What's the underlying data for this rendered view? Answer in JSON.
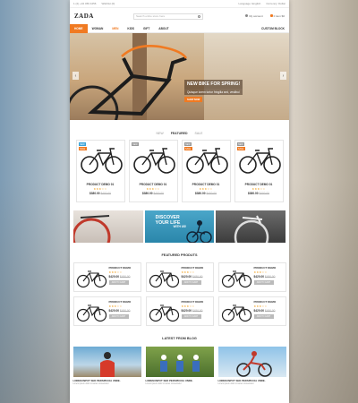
{
  "topbar": {
    "phone": "1 (2) +34 456 4456",
    "wishlist": "Wishlist (0)",
    "language": "Language: English",
    "currency": "Currency: Dollar"
  },
  "header": {
    "logo": "ZADA",
    "search_placeholder": "Search entire store here",
    "account": "My account",
    "cart": "0 item $0"
  },
  "nav": {
    "items": [
      "HOME",
      "WOMAN",
      "MEN",
      "KIDS",
      "GIFT",
      "ABOUT"
    ],
    "custom": "CUSTOM BLOCK"
  },
  "hero": {
    "title": "NEW BIKE FOR SPRING!",
    "subtitle": "Quisque lorem tortor fringilla sed, vestibul",
    "button": "SHOP NOW"
  },
  "tabs": {
    "new": "NEW",
    "featured": "FEATURED",
    "sale": "SALE"
  },
  "products": [
    {
      "name": "PRODUCT DEMO 01",
      "stars": "★★★☆☆",
      "price": "$380.00",
      "old": "$400.00",
      "badge1": "NEW",
      "badge2": "SALE"
    },
    {
      "name": "PRODUCT DEMO 01",
      "stars": "★★★☆☆",
      "price": "$380.00",
      "old": "$400.00",
      "badge1": "NEW",
      "badge2": ""
    },
    {
      "name": "PRODUCT DEMO 01",
      "stars": "★★★☆☆",
      "price": "$380.00",
      "old": "$400.00",
      "badge1": "NEW",
      "badge2": "SALE"
    },
    {
      "name": "PRODUCT DEMO 01",
      "stars": "★★★☆☆",
      "price": "$380.00",
      "old": "$400.00",
      "badge1": "NEW",
      "badge2": "SALE"
    }
  ],
  "banner": {
    "discover": "DISCOVER",
    "line2": "YOUR LIFE",
    "line3": "WITH US!"
  },
  "featured": {
    "title": "FEATURED PRODUTS",
    "name": "PRODUCT DEMO",
    "stars": "★★★☆☆",
    "price": "$420.00",
    "old": "$450.00",
    "button": "ADD TO CART"
  },
  "blog": {
    "title": "LATEST FROM BLOG",
    "post_title": "LOREM INPUT SED PERSPICCIA UNDE.",
    "post_meta": "Lorem ipsum dolor sit amet consectetur"
  },
  "colors": {
    "accent": "#f07a22",
    "new_badge": "#3aa3d8"
  }
}
